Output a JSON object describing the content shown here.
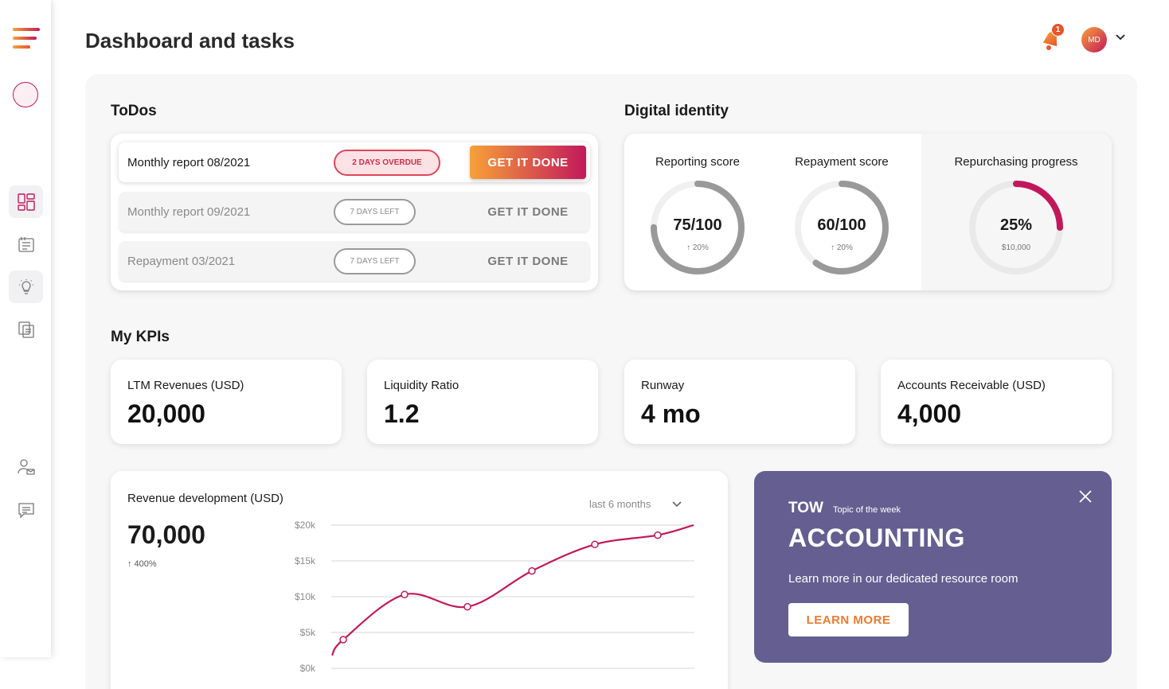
{
  "header": {
    "title": "Dashboard and tasks",
    "notification_count": "1",
    "user_initials": "MD"
  },
  "todos": {
    "title": "ToDos",
    "items": [
      {
        "label": "Monthly report 08/2021",
        "badge": "2 DAYS OVERDUE",
        "button": "GET IT DONE"
      },
      {
        "label": "Monthly report 09/2021",
        "badge": "7 DAYS LEFT",
        "button": "GET IT DONE"
      },
      {
        "label": "Repayment 03/2021",
        "badge": "7 DAYS LEFT",
        "button": "GET IT DONE"
      }
    ]
  },
  "identity": {
    "title": "Digital identity",
    "gauges": [
      {
        "title": "Reporting score",
        "value": "75/100",
        "sub": "↑ 20%",
        "fraction": 0.75
      },
      {
        "title": "Repayment score",
        "value": "60/100",
        "sub": "↑ 20%",
        "fraction": 0.6
      },
      {
        "title": "Repurchasing progress",
        "value": "25%",
        "sub": "$10,000",
        "fraction": 0.25
      }
    ]
  },
  "kpis": {
    "title": "My KPIs",
    "items": [
      {
        "label": "LTM Revenues (USD)",
        "value": "20,000"
      },
      {
        "label": "Liquidity Ratio",
        "value": "1.2"
      },
      {
        "label": "Runway",
        "value": "4 mo"
      },
      {
        "label": "Accounts Receivable (USD)",
        "value": "4,000"
      }
    ]
  },
  "revenue": {
    "title": "Revenue development (USD)",
    "value": "70,000",
    "change": "↑ 400%",
    "period": "last 6 months"
  },
  "chart_data": {
    "type": "line",
    "y_ticks": [
      "$20k",
      "$15k",
      "$10k",
      "$5k",
      "$0k"
    ],
    "ylim": [
      0,
      20000
    ],
    "x": [
      1,
      2,
      3,
      4,
      5,
      6
    ],
    "values": [
      4000,
      10300,
      8600,
      13600,
      17300,
      18600
    ],
    "line_color": "#c2185b",
    "grid": true
  },
  "tow": {
    "tag": "TOW",
    "tag_sub": "Topic of the week",
    "title": "ACCOUNTING",
    "description": "Learn more in our dedicated resource room",
    "button": "LEARN MORE"
  },
  "colors": {
    "accent_start": "#f7a139",
    "accent_end": "#c2185b",
    "tow_bg": "#655e91"
  }
}
